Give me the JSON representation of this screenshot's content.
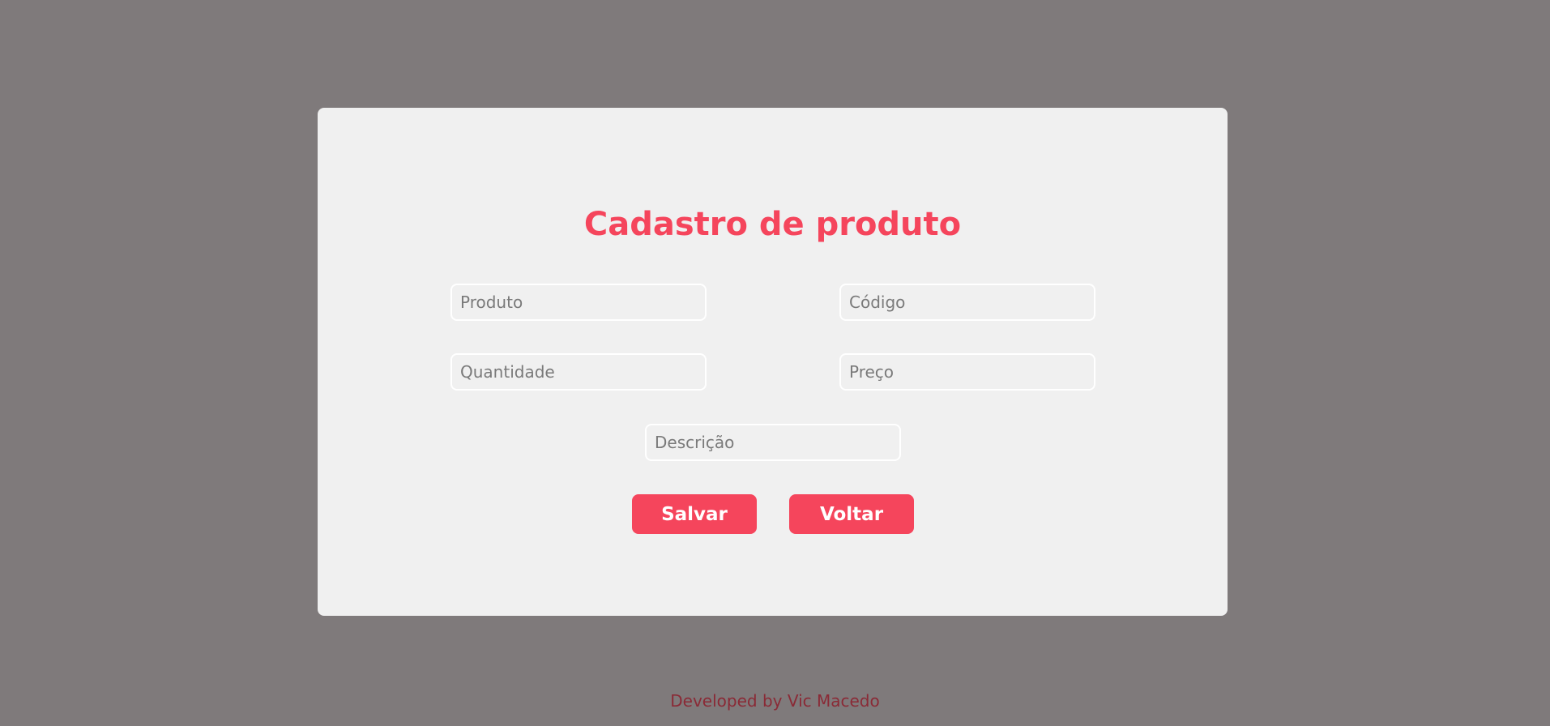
{
  "form": {
    "title": "Cadastro de produto",
    "fields": {
      "produto": {
        "placeholder": "Produto",
        "value": ""
      },
      "codigo": {
        "placeholder": "Código",
        "value": ""
      },
      "quantidade": {
        "placeholder": "Quantidade",
        "value": ""
      },
      "preco": {
        "placeholder": "Preço",
        "value": ""
      },
      "descricao": {
        "placeholder": "Descrição",
        "value": ""
      }
    },
    "buttons": {
      "save_label": "Salvar",
      "back_label": "Voltar"
    }
  },
  "footer": {
    "credit": "Developed by Vic Macedo"
  },
  "colors": {
    "background": "#7f7a7b",
    "card": "#f0f0f0",
    "accent": "#f5455c",
    "footer_text": "#8a2a36"
  }
}
